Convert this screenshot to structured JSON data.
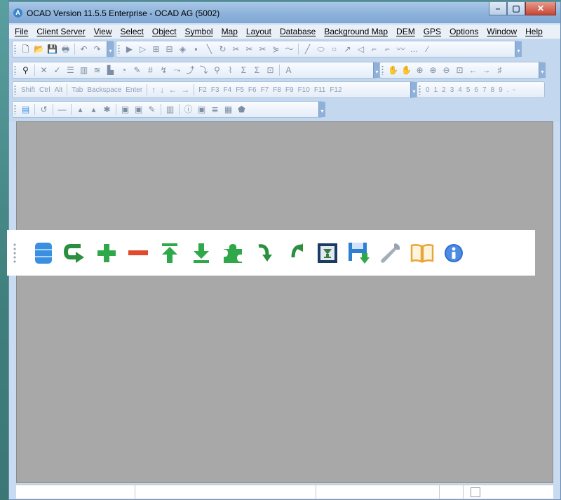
{
  "window": {
    "title": "OCAD Version 11.5.5  Enterprise - OCAD AG (5002)",
    "app_icon_letter": "A"
  },
  "menu": [
    "File",
    "Client Server",
    "View",
    "Select",
    "Object",
    "Symbol",
    "Map",
    "Layout",
    "Database",
    "Background Map",
    "DEM",
    "GPS",
    "Options",
    "Window",
    "Help"
  ],
  "keyboard_bar": {
    "keys_left": [
      "Shift",
      "Ctrl",
      "Alt"
    ],
    "keys_mid": [
      "Tab",
      "Backspace",
      "Enter"
    ],
    "arrows": [
      "↑",
      "↓",
      "←",
      "→"
    ],
    "function_keys": [
      "F2",
      "F3",
      "F4",
      "F5",
      "F6",
      "F7",
      "F8",
      "F9",
      "F10",
      "F11",
      "F12"
    ],
    "digits": [
      "0",
      "1",
      "2",
      "3",
      "4",
      "5",
      "6",
      "7",
      "8",
      "9",
      ".",
      "-"
    ]
  },
  "zoomed_toolbar": {
    "icons": [
      {
        "name": "database-icon",
        "color": "#3b8fe0"
      },
      {
        "name": "refresh-arrow-icon",
        "color": "#33a14a"
      },
      {
        "name": "plus-icon",
        "color": "#2fa84a"
      },
      {
        "name": "minus-icon",
        "color": "#e04a2e"
      },
      {
        "name": "upload-icon",
        "color": "#2fa84a"
      },
      {
        "name": "download-icon",
        "color": "#2fa84a"
      },
      {
        "name": "puzzle-icon",
        "color": "#2fa84a"
      },
      {
        "name": "undo-arrow-icon",
        "color": "#2fa84a"
      },
      {
        "name": "redo-arrow-icon",
        "color": "#2fa84a"
      },
      {
        "name": "picture-frame-icon",
        "color": "#1c3a64"
      },
      {
        "name": "save-download-icon",
        "color": "#2f7fd0"
      },
      {
        "name": "wrench-icon",
        "color": "#9aa3ad"
      },
      {
        "name": "book-icon",
        "color": "#e9a43a"
      },
      {
        "name": "info-icon",
        "color": "#2f6fd0"
      }
    ]
  }
}
